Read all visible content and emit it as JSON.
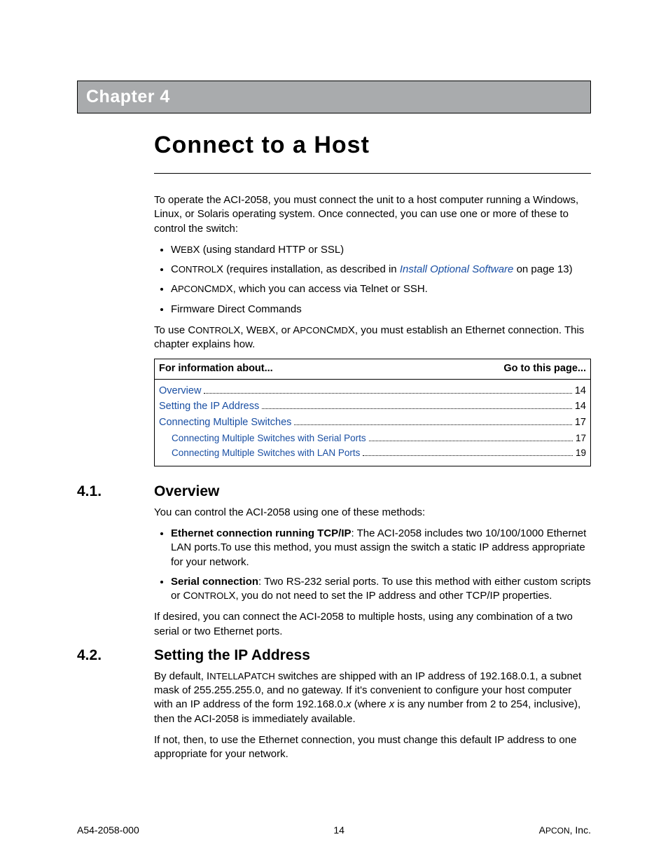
{
  "chapter": {
    "band": "Chapter 4",
    "title": "Connect to a Host"
  },
  "intro": {
    "p1": "To operate the ACI-2058, you must connect the unit to a host computer running a Windows, Linux, or Solaris operating system. Once connected, you can use one or more of these to control the switch:",
    "bullets": {
      "b1_pre": "W",
      "b1_sc": "EB",
      "b1_post": "X  (using standard HTTP or SSL)",
      "b2_pre": "C",
      "b2_sc": "ONTROL",
      "b2_mid": "X (requires installation, as described in ",
      "b2_link": "Install Optional Software",
      "b2_post": " on page 13)",
      "b3_pre": "A",
      "b3_sc1": "PCON",
      "b3_mid1": "C",
      "b3_sc2": "MD",
      "b3_post": "X, which you can access via Telnet or SSH.",
      "b4": "Firmware Direct Commands"
    },
    "p2_a": "To use C",
    "p2_sc1": "ONTROL",
    "p2_b": "X, W",
    "p2_sc2": "EB",
    "p2_c": "X, or A",
    "p2_sc3": "PCON",
    "p2_d": "C",
    "p2_sc4": "MD",
    "p2_e": "X, you must establish an Ethernet connection. This chapter explains how."
  },
  "toc": {
    "hleft": "For information about...",
    "hright": "Go to this page...",
    "rows": [
      {
        "label": "Overview",
        "page": "14",
        "indent": false
      },
      {
        "label": "Setting the IP Address",
        "page": "14",
        "indent": false
      },
      {
        "label": "Connecting Multiple Switches",
        "page": "17",
        "indent": false
      },
      {
        "label": "Connecting Multiple Switches with Serial Ports",
        "page": "17",
        "indent": true
      },
      {
        "label": "Connecting Multiple Switches with LAN Ports",
        "page": "19",
        "indent": true
      }
    ]
  },
  "s41": {
    "num": "4.1.",
    "title": "Overview",
    "p1": "You can control the ACI-2058 using one of these methods:",
    "b1_bold": "Ethernet connection running TCP/IP",
    "b1_rest": ": The ACI-2058 includes two 10/100/1000 Ethernet LAN ports.To use this method, you must assign the switch a static IP address appropriate for your network.",
    "b2_bold": "Serial connection",
    "b2_a": ": Two RS-232 serial ports. To use this method with either custom scripts or C",
    "b2_sc": "ONTROL",
    "b2_b": "X, you do not need to set the IP address and other TCP/IP properties.",
    "p2": "If desired, you can connect the ACI-2058 to multiple hosts, using any combination of a two serial or two Ethernet ports."
  },
  "s42": {
    "num": "4.2.",
    "title": "Setting the IP Address",
    "p1_a": "By default, I",
    "p1_sc": "NTELLA",
    "p1_b": "P",
    "p1_sc2": "ATCH",
    "p1_c": " switches are shipped with an IP address of 192.168.0.1, a subnet mask of 255.255.255.0, and no gateway. If it's convenient to configure your host computer with an IP address of the form 192.168.0.",
    "p1_it": "x",
    "p1_d": " (where ",
    "p1_it2": "x",
    "p1_e": " is any number from 2 to 254, inclusive), then the ACI-2058 is immediately available.",
    "p2": "If not, then, to use the Ethernet connection, you must change this default IP address to one appropriate for your network."
  },
  "footer": {
    "left": "A54-2058-000",
    "mid": "14",
    "right_a": "A",
    "right_sc": "PCON",
    "right_b": ", Inc."
  }
}
